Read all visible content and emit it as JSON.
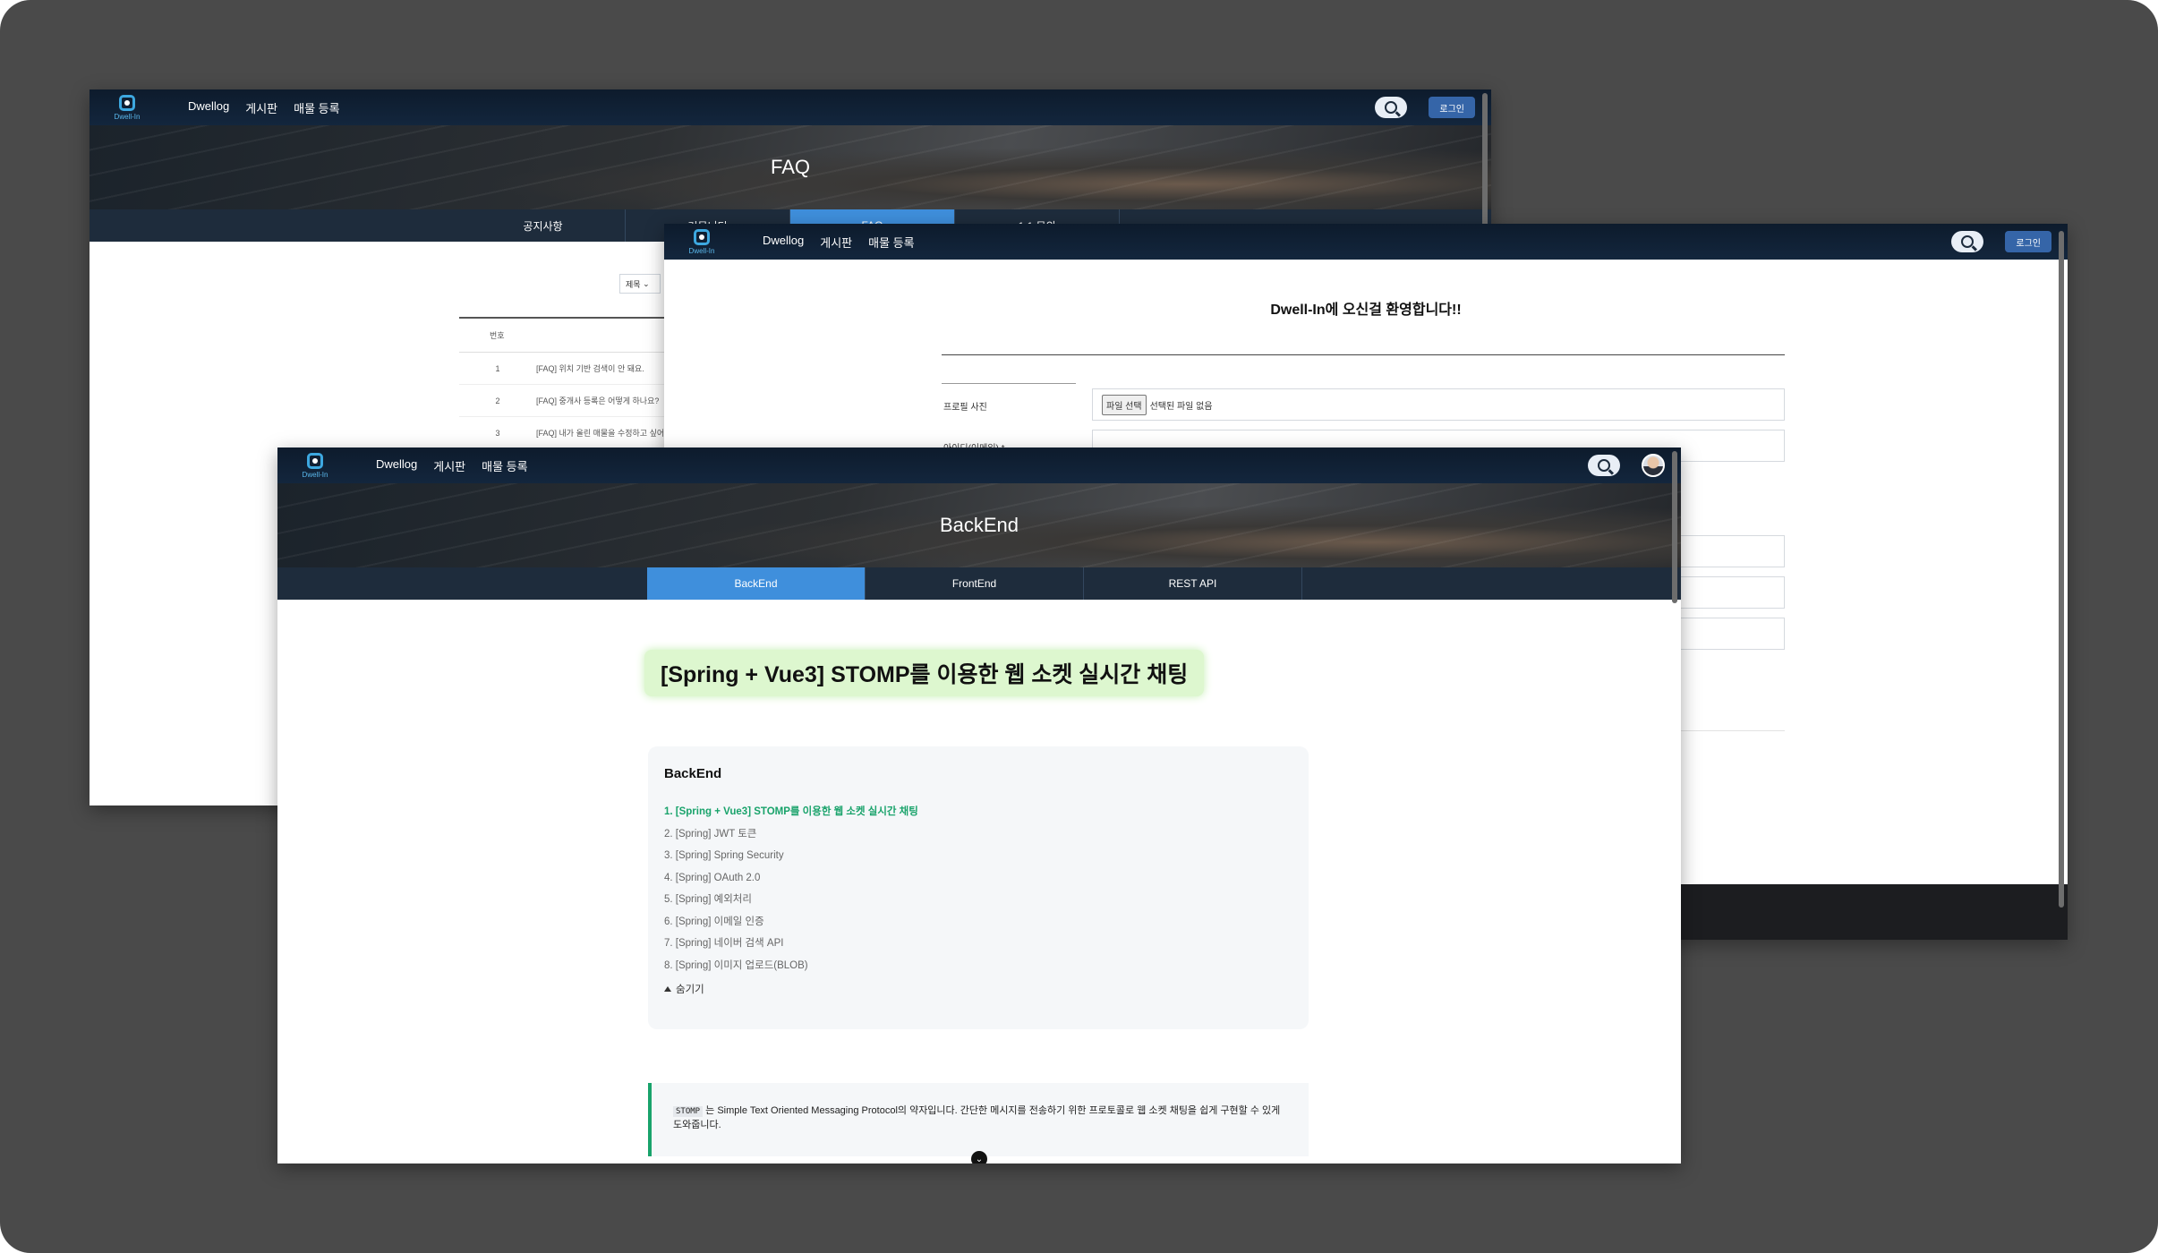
{
  "nav": {
    "logo_text": "Dwell-In",
    "menu": [
      "Dwellog",
      "게시판",
      "매물 등록"
    ],
    "login_label": "로그인"
  },
  "faq_window": {
    "hero_title": "FAQ",
    "tabs": [
      "공지사항",
      "커뮤니티",
      "FAQ",
      "1:1 문의"
    ],
    "active_tab": "FAQ",
    "select_value": "제목",
    "table_header": "번호",
    "rows": [
      {
        "num": "1",
        "title": "[FAQ] 위치 기반 검색이 안 돼요."
      },
      {
        "num": "2",
        "title": "[FAQ] 중개사 등록은 어떻게 하나요?"
      },
      {
        "num": "3",
        "title": "[FAQ] 내가 올린 매물을 수정하고 싶어요."
      }
    ]
  },
  "signup_window": {
    "welcome": "Dwell-In에 오신걸 환영합니다!!",
    "profile_label": "프로필 사진",
    "file_button": "파일 선택",
    "file_status": "선택된 파일 없음",
    "id_label": "아이디(이메일) *"
  },
  "article_window": {
    "hero_title": "BackEnd",
    "tabs": [
      "BackEnd",
      "FrontEnd",
      "REST API"
    ],
    "active_tab": "BackEnd",
    "post_title": "[Spring + Vue3] STOMP를 이용한 웹 소켓 실시간 채팅",
    "series": {
      "heading": "BackEnd",
      "items": [
        "1. [Spring + Vue3] STOMP를 이용한 웹 소켓 실시간 채팅",
        "2. [Spring] JWT 토큰",
        "3. [Spring] Spring Security",
        "4. [Spring] OAuth 2.0",
        "5. [Spring] 예외처리",
        "6. [Spring] 이메일 인증",
        "7. [Spring] 네이버 검색 API",
        "8. [Spring] 이미지 업로드(BLOB)"
      ],
      "current_index": 0,
      "hide_label": "숨기기"
    },
    "quote": {
      "code": "STOMP",
      "text": "는 Simple Text Oriented Messaging Protocol의 약자입니다. 간단한 메시지를 전송하기 위한 프로토콜로 웹 소켓 채팅을 쉽게 구현할 수 있게 도와줍니다."
    }
  },
  "colors": {
    "nav_bg": "#13263d",
    "active_tab": "#3f8fdc",
    "accent_green": "#19a36b",
    "title_highlight": "#ddf7cf",
    "login_btn": "#3565a8"
  }
}
